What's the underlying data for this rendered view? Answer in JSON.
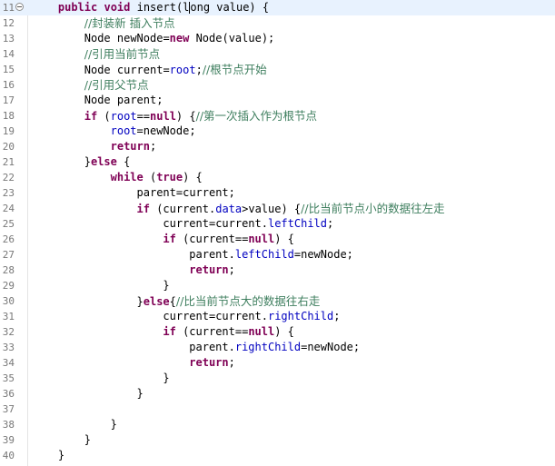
{
  "editor": {
    "lines": [
      {
        "num": "11",
        "fold": true,
        "current": true,
        "indent": 4,
        "tokens": [
          [
            "kw",
            "public"
          ],
          [
            "t",
            " "
          ],
          [
            "kw",
            "void"
          ],
          [
            "t",
            " insert(l"
          ],
          [
            "caret",
            ""
          ],
          [
            "t",
            "ong value) {"
          ]
        ]
      },
      {
        "num": "12",
        "indent": 8,
        "tokens": [
          [
            "cm",
            "//封装新 插入节点"
          ]
        ]
      },
      {
        "num": "13",
        "indent": 8,
        "tokens": [
          [
            "t",
            "Node newNode="
          ],
          [
            "kw",
            "new"
          ],
          [
            "t",
            " Node(value);"
          ]
        ]
      },
      {
        "num": "14",
        "indent": 8,
        "tokens": [
          [
            "cm",
            "//引用当前节点"
          ]
        ]
      },
      {
        "num": "15",
        "indent": 8,
        "tokens": [
          [
            "t",
            "Node current="
          ],
          [
            "fd",
            "root"
          ],
          [
            "t",
            ";"
          ],
          [
            "cm",
            "//根节点开始"
          ]
        ]
      },
      {
        "num": "16",
        "indent": 8,
        "tokens": [
          [
            "cm",
            "//引用父节点"
          ]
        ]
      },
      {
        "num": "17",
        "indent": 8,
        "tokens": [
          [
            "t",
            "Node parent;"
          ]
        ]
      },
      {
        "num": "18",
        "indent": 8,
        "tokens": [
          [
            "kw",
            "if"
          ],
          [
            "t",
            " ("
          ],
          [
            "fd",
            "root"
          ],
          [
            "t",
            "=="
          ],
          [
            "kw",
            "null"
          ],
          [
            "t",
            ") {"
          ],
          [
            "cm",
            "//第一次插入作为根节点"
          ]
        ]
      },
      {
        "num": "19",
        "indent": 12,
        "tokens": [
          [
            "fd",
            "root"
          ],
          [
            "t",
            "=newNode;"
          ]
        ]
      },
      {
        "num": "20",
        "indent": 12,
        "tokens": [
          [
            "kw",
            "return"
          ],
          [
            "t",
            ";"
          ]
        ]
      },
      {
        "num": "21",
        "indent": 8,
        "tokens": [
          [
            "t",
            "}"
          ],
          [
            "kw",
            "else"
          ],
          [
            "t",
            " {"
          ]
        ]
      },
      {
        "num": "22",
        "indent": 12,
        "tokens": [
          [
            "kw",
            "while"
          ],
          [
            "t",
            " ("
          ],
          [
            "kw",
            "true"
          ],
          [
            "t",
            ") {"
          ]
        ]
      },
      {
        "num": "23",
        "indent": 16,
        "tokens": [
          [
            "t",
            "parent=current;"
          ]
        ]
      },
      {
        "num": "24",
        "indent": 16,
        "tokens": [
          [
            "kw",
            "if"
          ],
          [
            "t",
            " (current."
          ],
          [
            "fd",
            "data"
          ],
          [
            "t",
            ">value) {"
          ],
          [
            "cm",
            "//比当前节点小的数据往左走"
          ]
        ]
      },
      {
        "num": "25",
        "indent": 20,
        "tokens": [
          [
            "t",
            "current=current."
          ],
          [
            "fd",
            "leftChild"
          ],
          [
            "t",
            ";"
          ]
        ]
      },
      {
        "num": "26",
        "indent": 20,
        "tokens": [
          [
            "kw",
            "if"
          ],
          [
            "t",
            " (current=="
          ],
          [
            "kw",
            "null"
          ],
          [
            "t",
            ") {"
          ]
        ]
      },
      {
        "num": "27",
        "indent": 24,
        "tokens": [
          [
            "t",
            "parent."
          ],
          [
            "fd",
            "leftChild"
          ],
          [
            "t",
            "=newNode;"
          ]
        ]
      },
      {
        "num": "28",
        "indent": 24,
        "tokens": [
          [
            "kw",
            "return"
          ],
          [
            "t",
            ";"
          ]
        ]
      },
      {
        "num": "29",
        "indent": 20,
        "tokens": [
          [
            "t",
            "}"
          ]
        ]
      },
      {
        "num": "30",
        "indent": 16,
        "tokens": [
          [
            "t",
            "}"
          ],
          [
            "kw",
            "else"
          ],
          [
            "t",
            "{"
          ],
          [
            "cm",
            "//比当前节点大的数据往右走"
          ]
        ]
      },
      {
        "num": "31",
        "indent": 20,
        "tokens": [
          [
            "t",
            "current=current."
          ],
          [
            "fd",
            "rightChild"
          ],
          [
            "t",
            ";"
          ]
        ]
      },
      {
        "num": "32",
        "indent": 20,
        "tokens": [
          [
            "kw",
            "if"
          ],
          [
            "t",
            " (current=="
          ],
          [
            "kw",
            "null"
          ],
          [
            "t",
            ") {"
          ]
        ]
      },
      {
        "num": "33",
        "indent": 24,
        "tokens": [
          [
            "t",
            "parent."
          ],
          [
            "fd",
            "rightChild"
          ],
          [
            "t",
            "=newNode;"
          ]
        ]
      },
      {
        "num": "34",
        "indent": 24,
        "tokens": [
          [
            "kw",
            "return"
          ],
          [
            "t",
            ";"
          ]
        ]
      },
      {
        "num": "35",
        "indent": 20,
        "tokens": [
          [
            "t",
            "}"
          ]
        ]
      },
      {
        "num": "36",
        "indent": 16,
        "tokens": [
          [
            "t",
            "}"
          ]
        ]
      },
      {
        "num": "37",
        "indent": 0,
        "tokens": []
      },
      {
        "num": "38",
        "indent": 12,
        "tokens": [
          [
            "t",
            "}"
          ]
        ]
      },
      {
        "num": "39",
        "indent": 8,
        "tokens": [
          [
            "t",
            "}"
          ]
        ]
      },
      {
        "num": "40",
        "indent": 4,
        "tokens": [
          [
            "t",
            "}"
          ]
        ]
      }
    ]
  },
  "colors": {
    "keyword": "#7f0055",
    "comment": "#3f7f5f",
    "field": "#0000c0",
    "current_line": "#e8f2fe",
    "line_number": "#787878"
  }
}
